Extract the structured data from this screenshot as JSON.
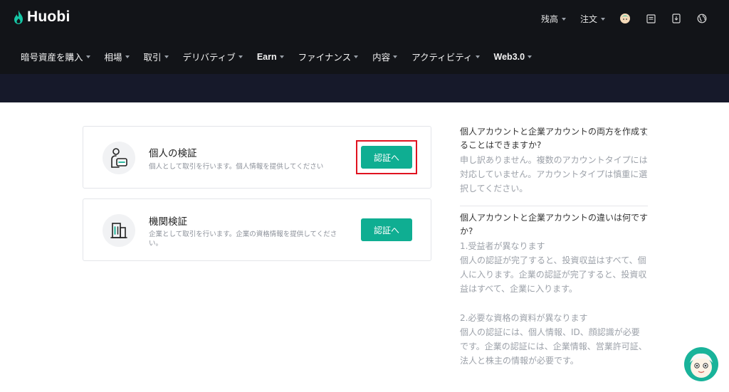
{
  "header": {
    "logo_text": "Huobi",
    "top_links": [
      {
        "label": "残高"
      },
      {
        "label": "注文"
      }
    ],
    "nav": [
      {
        "label": "暗号資産を購入"
      },
      {
        "label": "相場"
      },
      {
        "label": "取引"
      },
      {
        "label": "デリバティブ"
      },
      {
        "label": "Earn"
      },
      {
        "label": "ファイナンス"
      },
      {
        "label": "内容"
      },
      {
        "label": "アクティビティ"
      },
      {
        "label": "Web3.0"
      }
    ]
  },
  "cards": [
    {
      "title": "個人の検証",
      "description": "個人として取引を行います。個人情報を提供してください",
      "button": "認証へ",
      "icon": "person-id-icon"
    },
    {
      "title": "機関検証",
      "description": "企業として取引を行います。企業の資格情報を提供してください。",
      "button": "認証へ",
      "icon": "building-icon"
    }
  ],
  "faq": [
    {
      "question": "個人アカウントと企業アカウントの両方を作成することはできますか?",
      "answer": "申し訳ありません。複数のアカウントタイプには対応していません。アカウントタイプは慎重に選択してください。"
    },
    {
      "question": "個人アカウントと企業アカウントの違いは何ですか?",
      "answer_1_title": "1.受益者が異なります",
      "answer_1_body": "個人の認証が完了すると、投資収益はすべて、個人に入ります。企業の認証が完了すると、投資収益はすべて、企業に入ります。",
      "answer_2_title": "2.必要な資格の資料が異なります",
      "answer_2_body": "個人の認証には、個人情報、ID、顔認識が必要です。企業の認証には、企業情報、営業許可証、法人と株主の情報が必要です。"
    }
  ],
  "colors": {
    "header_bg": "#121418",
    "banner_bg": "#16192a",
    "accent": "#0fae92",
    "highlight": "#e0121f"
  }
}
